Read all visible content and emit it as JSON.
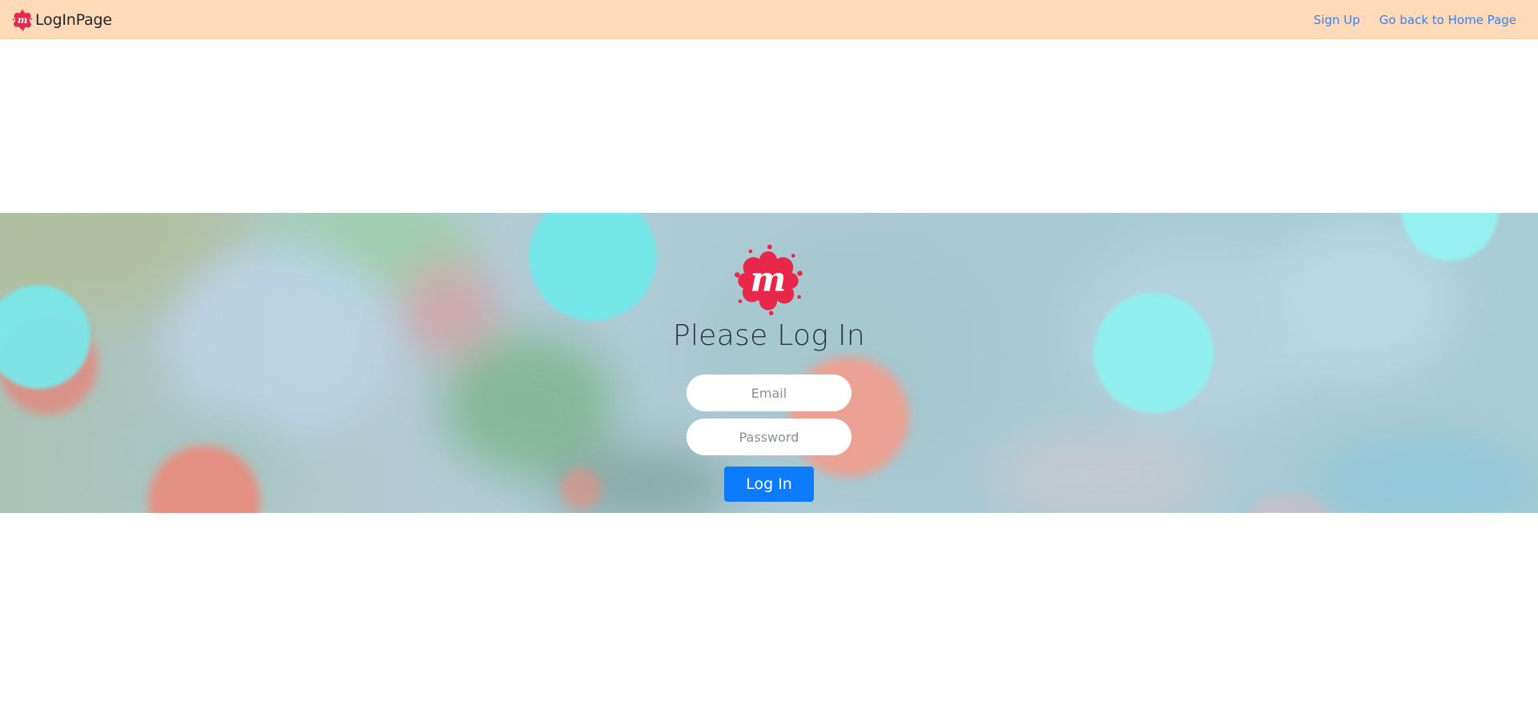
{
  "navbar": {
    "brand_text": "LogInPage",
    "links": [
      {
        "label": "Sign Up"
      },
      {
        "label": "Go back to Home Page"
      }
    ],
    "background_color": "#ffdab9",
    "link_color": "#3b82f6"
  },
  "hero": {
    "title": "Please Log In",
    "logo_icon": "meetup-logo-icon",
    "email_placeholder": "Email",
    "password_placeholder": "Password",
    "email_value": "",
    "password_value": "",
    "submit_label": "Log In",
    "button_color": "#0d7bfd",
    "logo_color": "#e8284a"
  }
}
